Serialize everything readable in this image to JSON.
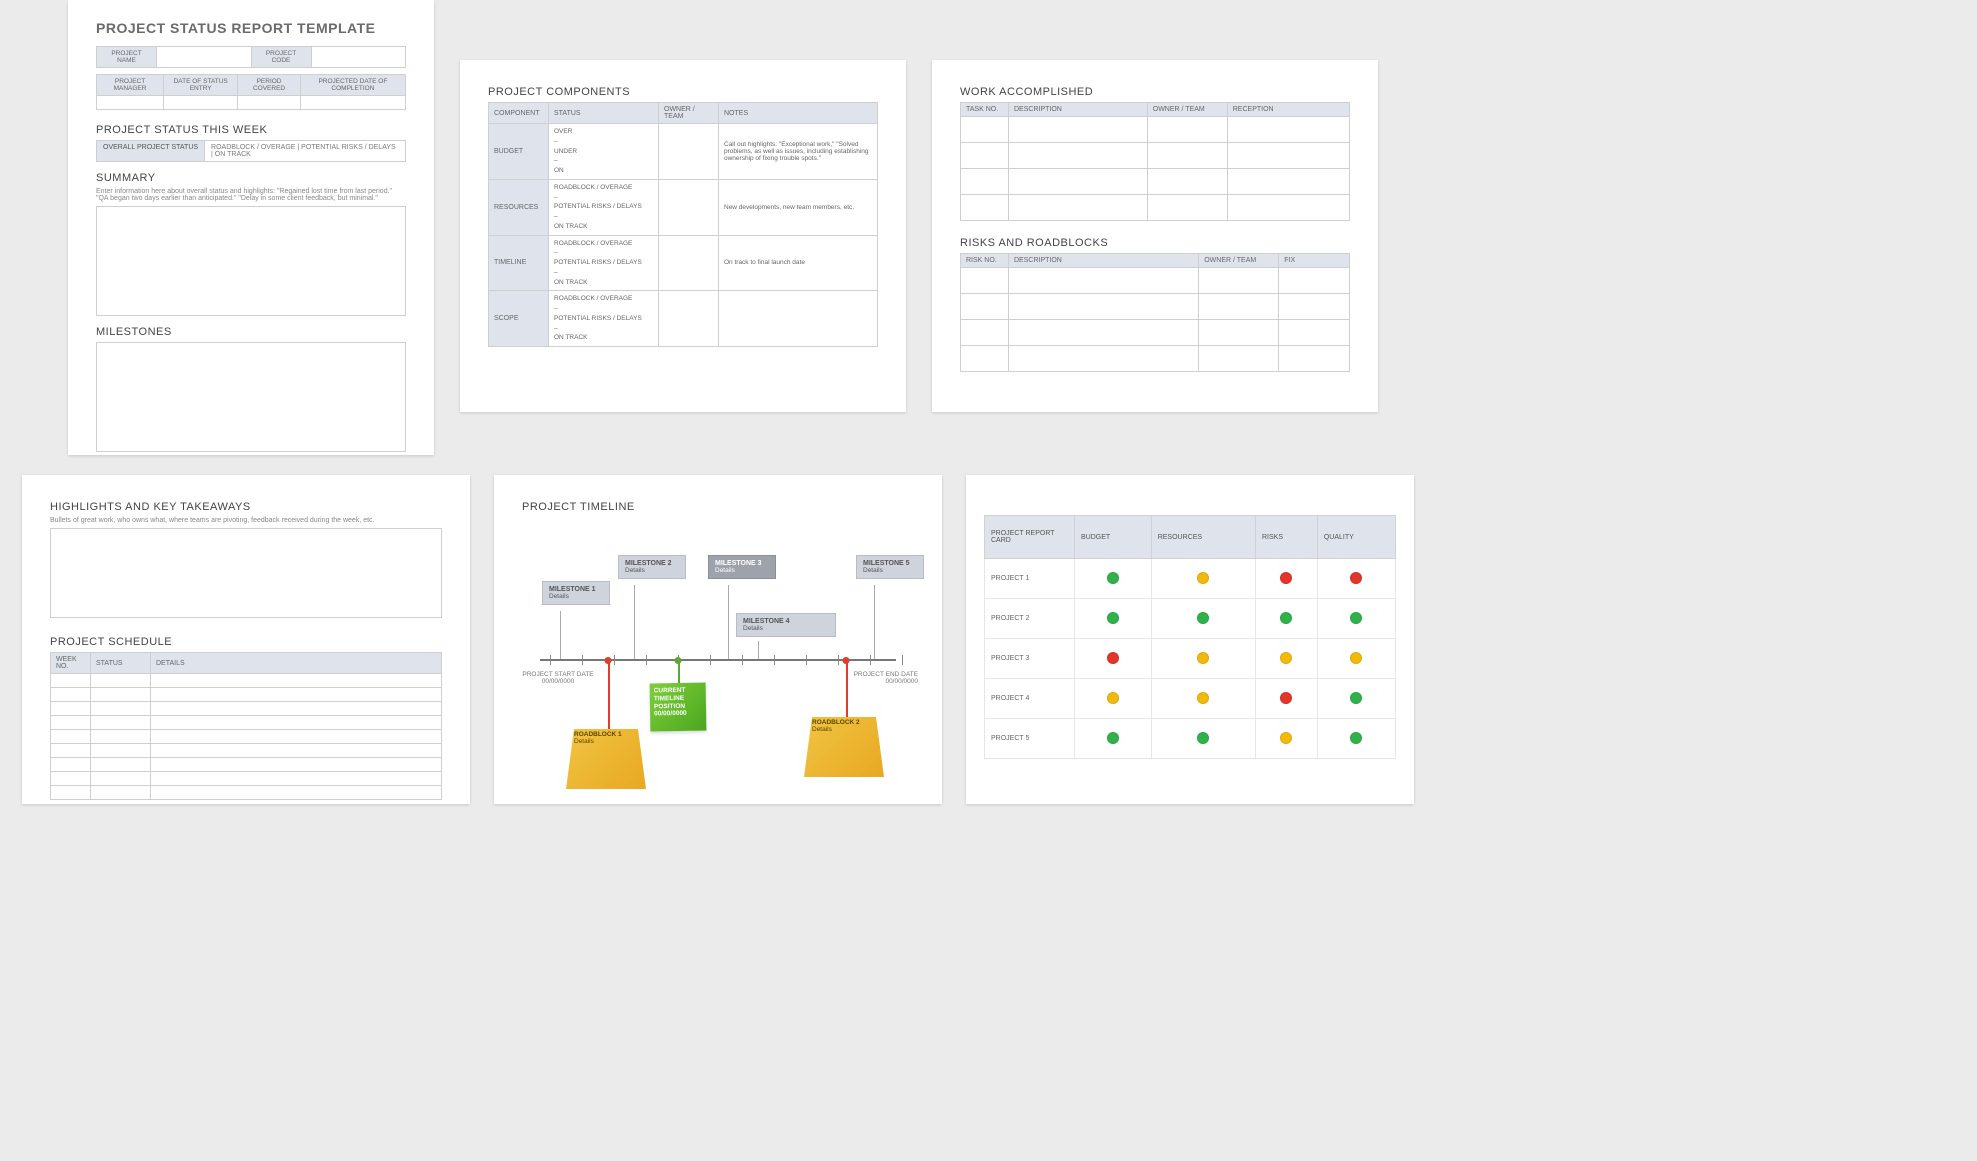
{
  "page1": {
    "title": "PROJECT STATUS REPORT TEMPLATE",
    "info_top": {
      "name": "PROJECT NAME",
      "code": "PROJECT CODE"
    },
    "info_cols": [
      "PROJECT MANAGER",
      "DATE OF STATUS ENTRY",
      "PERIOD COVERED",
      "PROJECTED DATE OF COMPLETION"
    ],
    "status_week": "PROJECT STATUS THIS WEEK",
    "overall_label": "OVERALL PROJECT STATUS",
    "overall_body": "ROADBLOCK / OVERAGE   |   POTENTIAL RISKS / DELAYS   |   ON TRACK",
    "summary_title": "SUMMARY",
    "summary_note": "Enter information here about overall status and highlights: \"Regained lost time from last period.\" \"QA began two days earlier than anticipated.\" \"Delay in some client feedback, but minimal.\"",
    "milestones_title": "MILESTONES"
  },
  "page2": {
    "title": "PROJECT COMPONENTS",
    "headers": [
      "COMPONENT",
      "STATUS",
      "OWNER / TEAM",
      "NOTES"
    ],
    "rows": [
      {
        "comp": "BUDGET",
        "status": "OVER\n–\nUNDER\n–\nON",
        "notes": "Call out highlights: \"Exceptional work,\" \"Solved problems, as well as issues, including establishing ownership of fixing trouble spots.\""
      },
      {
        "comp": "RESOURCES",
        "status": "ROADBLOCK / OVERAGE\n–\nPOTENTIAL RISKS / DELAYS\n–\nON TRACK",
        "notes": "New developments, new team members, etc."
      },
      {
        "comp": "TIMELINE",
        "status": "ROADBLOCK / OVERAGE\n–\nPOTENTIAL RISKS / DELAYS\n–\nON TRACK",
        "notes": "On track to final launch date"
      },
      {
        "comp": "SCOPE",
        "status": "ROADBLOCK / OVERAGE\n–\nPOTENTIAL RISKS / DELAYS\n–\nON TRACK",
        "notes": ""
      }
    ]
  },
  "page3": {
    "work_title": "WORK ACCOMPLISHED",
    "work_headers": [
      "TASK NO.",
      "DESCRIPTION",
      "OWNER / TEAM",
      "RECEPTION"
    ],
    "risks_title": "RISKS AND ROADBLOCKS",
    "risks_headers": [
      "RISK NO.",
      "DESCRIPTION",
      "OWNER / TEAM",
      "FIX"
    ]
  },
  "page4": {
    "hl_title": "HIGHLIGHTS AND KEY TAKEAWAYS",
    "hl_note": "Bullets of great work, who owns what, where teams are pivoting, feedback received during the week, etc.",
    "sched_title": "PROJECT SCHEDULE",
    "sched_headers": [
      "WEEK NO.",
      "STATUS",
      "DETAILS"
    ]
  },
  "page5": {
    "title": "PROJECT TIMELINE",
    "milestones": [
      {
        "n": "MILESTONE 1",
        "d": "Details"
      },
      {
        "n": "MILESTONE 2",
        "d": "Details"
      },
      {
        "n": "MILESTONE 3",
        "d": "Details"
      },
      {
        "n": "MILESTONE 4",
        "d": "Details"
      },
      {
        "n": "MILESTONE 5",
        "d": "Details"
      }
    ],
    "start_lbl": "PROJECT START DATE",
    "start_date": "00/00/0000",
    "end_lbl": "PROJECT END DATE",
    "end_date": "00/00/0000",
    "current_lbl": "CURRENT TIMELINE POSITION",
    "current_date": "00/00/0000",
    "rb1": "ROADBLOCK 1",
    "rb2": "ROADBLOCK 2",
    "rb_d": "Details"
  },
  "page6": {
    "corner": "PROJECT REPORT CARD",
    "cols": [
      "BUDGET",
      "RESOURCES",
      "RISKS",
      "QUALITY"
    ],
    "rows": [
      {
        "name": "PROJECT 1",
        "cells": [
          "g",
          "y",
          "r",
          "r"
        ]
      },
      {
        "name": "PROJECT 2",
        "cells": [
          "g",
          "g",
          "g",
          "g"
        ]
      },
      {
        "name": "PROJECT 3",
        "cells": [
          "r",
          "y",
          "y",
          "y"
        ]
      },
      {
        "name": "PROJECT 4",
        "cells": [
          "y",
          "y",
          "r",
          "g"
        ]
      },
      {
        "name": "PROJECT 5",
        "cells": [
          "g",
          "g",
          "y",
          "g"
        ]
      }
    ]
  }
}
